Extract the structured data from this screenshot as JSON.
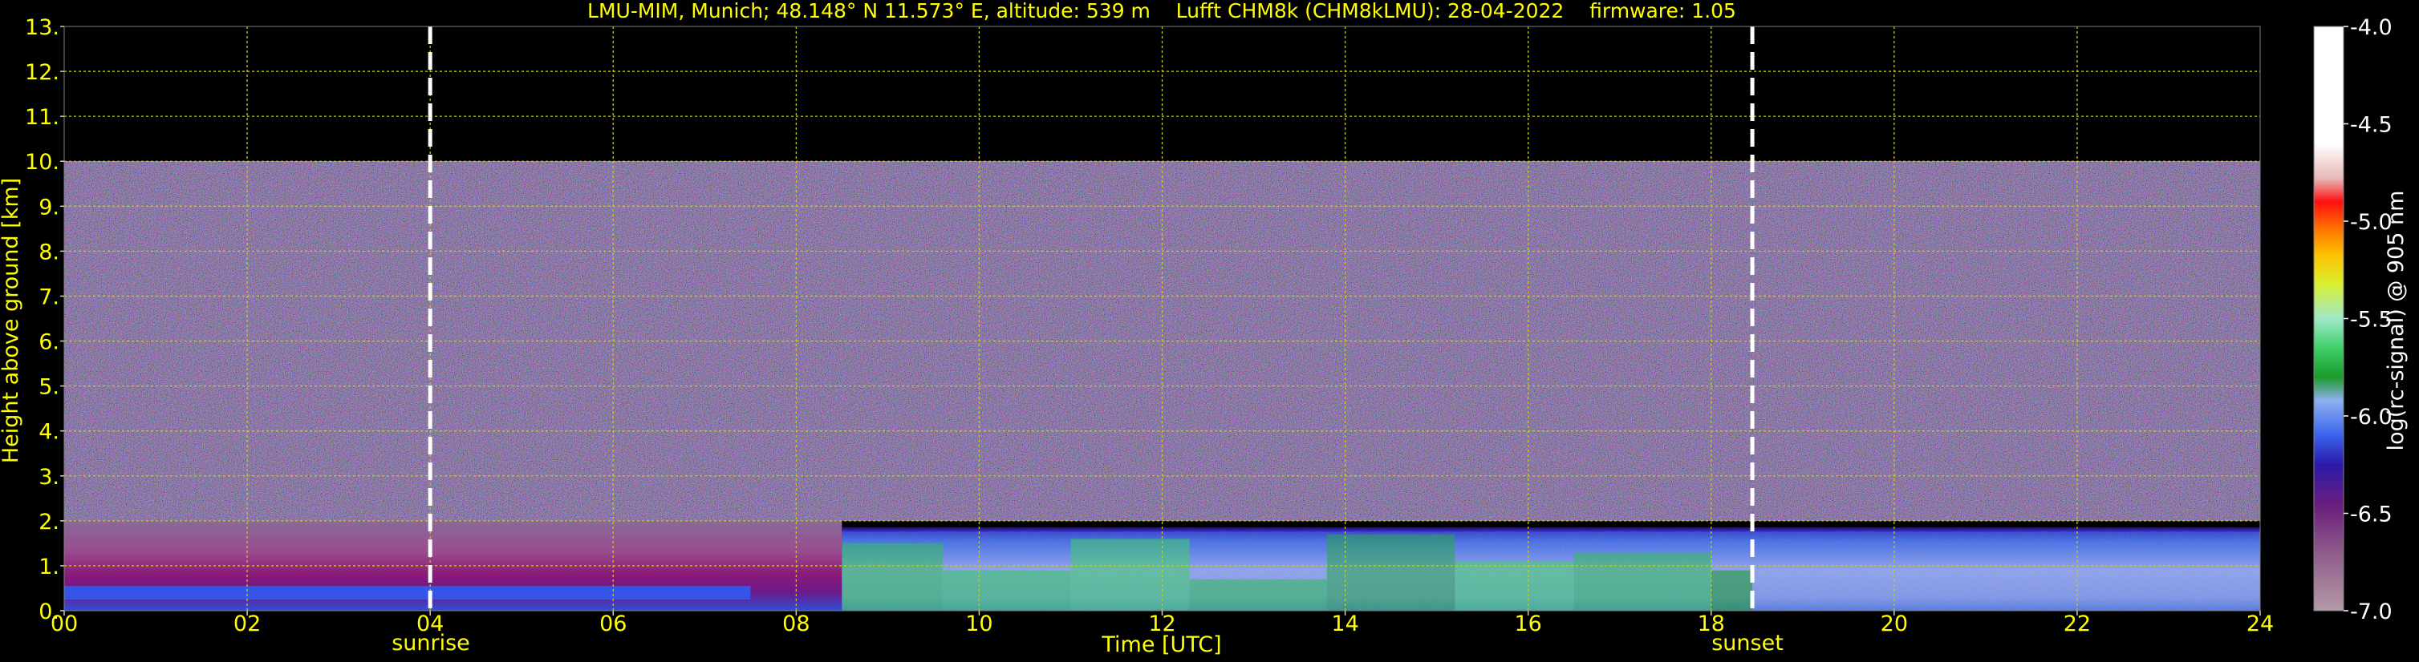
{
  "chart_data": {
    "type": "heatmap",
    "title": "LMU-MIM, Munich; 48.148° N 11.573° E, altitude: 539 m    Lufft CHM8k (CHM8kLMU): 28-04-2022    firmware: 1.05",
    "xlabel": "Time [UTC]",
    "ylabel": "Height above ground [km]",
    "xlim": [
      0,
      24
    ],
    "ylim": [
      0,
      13
    ],
    "x_ticks": [
      "00",
      "02",
      "04",
      "06",
      "08",
      "10",
      "12",
      "14",
      "16",
      "18",
      "20",
      "22",
      "24"
    ],
    "y_ticks": [
      "0.",
      "1.",
      "2.",
      "3.",
      "4.",
      "5.",
      "6.",
      "7.",
      "8.",
      "9.",
      "10.",
      "11.",
      "12.",
      "13."
    ],
    "grid": true,
    "annotations": [
      {
        "label": "sunrise",
        "x": 4.0
      },
      {
        "label": "sunset",
        "x": 18.45
      }
    ],
    "colorbar": {
      "label": "log(rc-signal) @ 905 nm",
      "range": [
        -7.0,
        -4.0
      ],
      "ticks": [
        "-4.0",
        "-4.5",
        "-5.0",
        "-5.5",
        "-6.0",
        "-6.5",
        "-7.0"
      ]
    },
    "regions": [
      {
        "name": "noise",
        "x": [
          0,
          24
        ],
        "y": [
          2.0,
          10.0
        ],
        "level": -6.5
      },
      {
        "name": "boundary-layer-morning",
        "x": [
          0,
          8.5
        ],
        "y": [
          0,
          2.0
        ],
        "level": -6.4
      },
      {
        "name": "boundary-layer-afternoon",
        "x": [
          8.5,
          24
        ],
        "y": [
          0,
          1.8
        ],
        "level": -6.1
      }
    ],
    "colors": {
      "background": "#000000",
      "text": "#ffff00",
      "grid": "#cccc00",
      "marker": "#ffffff"
    }
  }
}
